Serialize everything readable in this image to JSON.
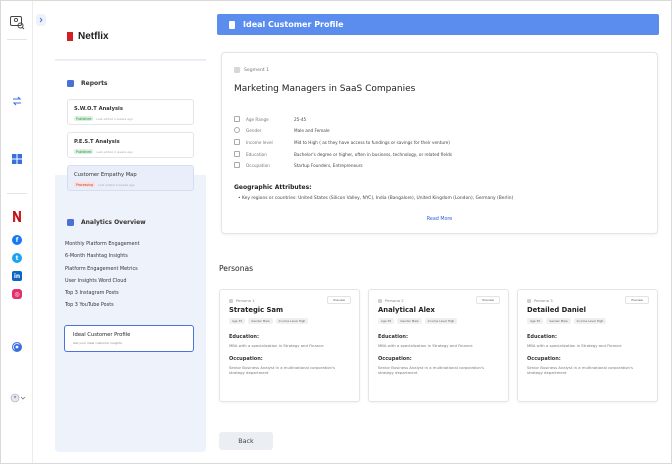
{
  "icons": {
    "top": "user-card-icon",
    "expand": "chevron-right-icon",
    "swap": "swap-icon",
    "dashboard": "dashboard-icon",
    "netflix": "netflix-icon",
    "facebook": "facebook-icon",
    "twitter": "twitter-icon",
    "linkedin": "linkedin-icon",
    "instagram": "instagram-icon",
    "signal": "broadcast-icon",
    "account": "account-icon",
    "dropdown": "chevron-down-icon"
  },
  "colors": {
    "accent": "#5b8def",
    "link": "#2e63d6",
    "netflix": "#d11f26",
    "facebook": "#1877f2",
    "twitter": "#1da1f2",
    "linkedin": "#0a66c2",
    "instagram": "#e1306c"
  },
  "sidebar": {
    "brand": "Netflix",
    "reports_title": "Reports",
    "reports": [
      {
        "title": "S.W.O.T Analysis",
        "badge": "Published",
        "meta": "Last edited 2 weeks ago"
      },
      {
        "title": "P.E.S.T Analysis",
        "badge": "Published",
        "meta": "Last edited 2 weeks ago"
      },
      {
        "title": "Customer Empathy Map",
        "badge": "Processing",
        "meta": "Last edited 2 weeks ago"
      }
    ],
    "analytics_title": "Analytics Overview",
    "analytics_items": [
      "Monthly Platform Engagement",
      "6-Month Hashtag Insights",
      "Platform Engagement Metrics",
      "User Insights Word Cloud",
      "Top 3 Instagram Posts",
      "Top 3 YouTube Posts"
    ],
    "icp": {
      "title": "Ideal Customer Profile",
      "subtitle": "Get your ideal customer insights"
    }
  },
  "main": {
    "title": "Ideal Customer Profile",
    "segment": {
      "label": "Segment 1",
      "title": "Marketing Managers in SaaS Companies",
      "attributes": [
        {
          "label": "Age Range",
          "value": "25-45"
        },
        {
          "label": "Gender",
          "value": "Male and Female"
        },
        {
          "label": "Income level",
          "value": "Mid to High ( as they have access to fundings or savings for their venture)"
        },
        {
          "label": "Education",
          "value": "Bachelor's degree or higher, often in business, technology, or related fields"
        },
        {
          "label": "Occupation",
          "value": "Startup Founders, Entrepreneurs"
        }
      ],
      "geo_title": "Geographic Attributes:",
      "geo_item": "Key regions or countries: United States (Silicon Valley, NYC), India (Bangalore), United Kingdom (London), Germany (Berlin)",
      "read_more": "Read More"
    },
    "personas_title": "Personas",
    "personas": [
      {
        "label": "Persona 1",
        "preview": "Preview",
        "name": "Strategic Sam",
        "tags": [
          "Age 35",
          "Gender Male",
          "Income Level High"
        ],
        "education_title": "Education:",
        "education": "MBA with a specialization in Strategy and Finance",
        "occupation_title": "Occupation:",
        "occupation": "Senior Business Analyst in a multinational corporation's strategy department"
      },
      {
        "label": "Persona 2",
        "preview": "Preview",
        "name": "Analytical Alex",
        "tags": [
          "Age 35",
          "Gender Male",
          "Income Level High"
        ],
        "education_title": "Education:",
        "education": "MBA with a specialization in Strategy and Finance",
        "occupation_title": "Occupation:",
        "occupation": "Senior Business Analyst in a multinational corporation's strategy department"
      },
      {
        "label": "Persona 3",
        "preview": "Preview",
        "name": "Detailed Daniel",
        "tags": [
          "Age 35",
          "Gender Male",
          "Income Level High"
        ],
        "education_title": "Education:",
        "education": "MBA with a specialization in Strategy and Finance",
        "occupation_title": "Occupation:",
        "occupation": "Senior Business Analyst in a multinational corporation's strategy department"
      }
    ],
    "back_label": "Back"
  }
}
